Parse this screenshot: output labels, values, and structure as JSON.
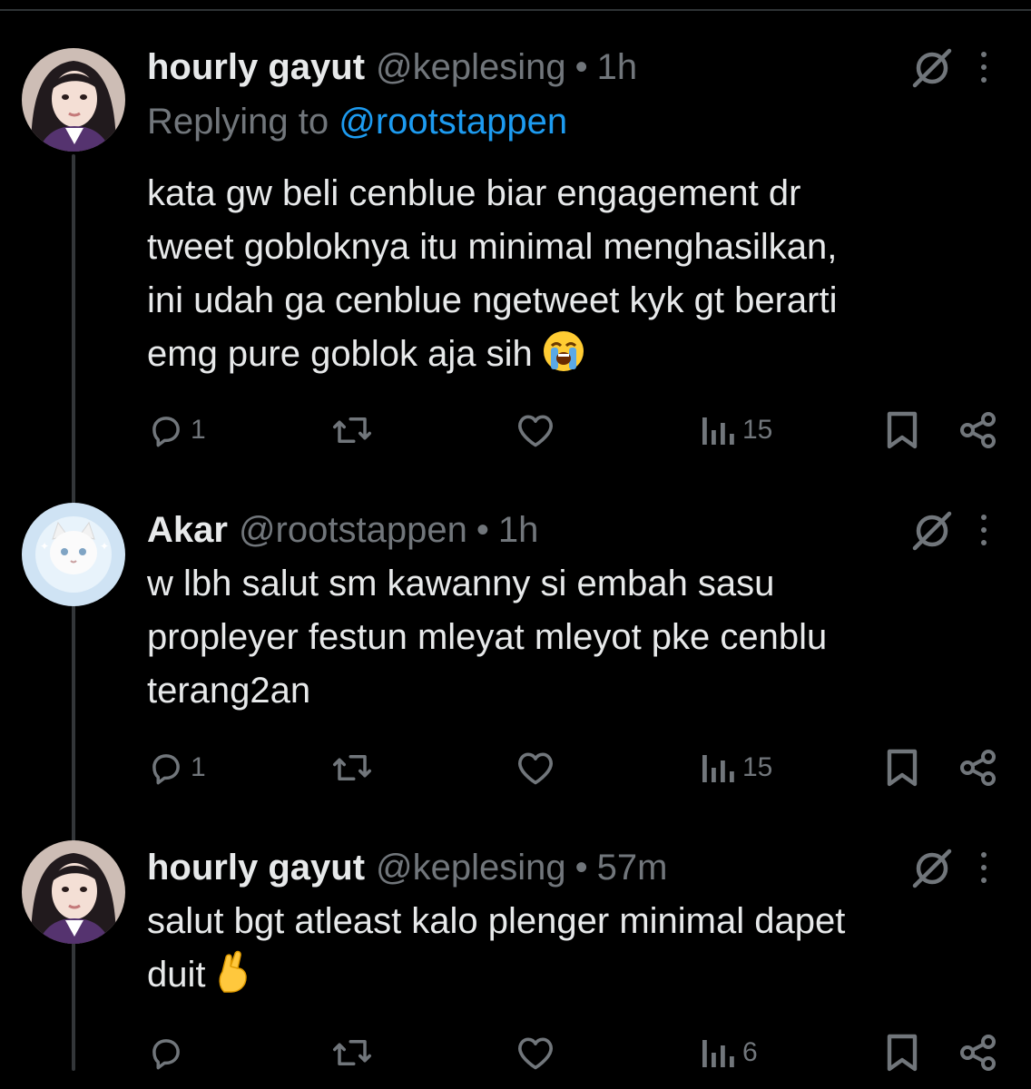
{
  "tweets": [
    {
      "display_name": "hourly gayut",
      "handle": "@keplesing",
      "separator": "•",
      "time": "1h",
      "replying_prefix": "Replying to",
      "replying_mention": "@rootstappen",
      "body_lines": [
        "kata gw beli cenblue biar engagement dr",
        "tweet gobloknya itu minimal menghasilkan,",
        "ini udah ga cenblue ngetweet kyk gt berarti",
        "emg pure goblok aja sih"
      ],
      "emoji": "😭",
      "replies": "1",
      "retweets": "",
      "likes": "",
      "views": "15"
    },
    {
      "display_name": "Akar",
      "handle": "@rootstappen",
      "separator": "•",
      "time": "1h",
      "body_lines": [
        "w lbh salut sm kawanny si embah sasu",
        "propleyer festun mleyat mleyot pke cenblu",
        "terang2an"
      ],
      "replies": "1",
      "retweets": "",
      "likes": "",
      "views": "15"
    },
    {
      "display_name": "hourly gayut",
      "handle": "@keplesing",
      "separator": "•",
      "time": "57m",
      "body_lines": [
        "salut bgt atleast kalo plenger minimal dapet",
        "duit"
      ],
      "emoji": "🤞",
      "replies": "",
      "retweets": "",
      "likes": "",
      "views": "6"
    }
  ],
  "icons": {
    "reply": "reply-icon",
    "retweet": "retweet-icon",
    "like": "heart-icon",
    "views": "views-icon",
    "bookmark": "bookmark-icon",
    "share": "share-icon",
    "grok": "grok-icon",
    "more": "more-icon"
  },
  "colors": {
    "background": "#000000",
    "text": "#e7e9ea",
    "muted": "#71767b",
    "link": "#1d9bf0",
    "thread_line": "#333639"
  }
}
